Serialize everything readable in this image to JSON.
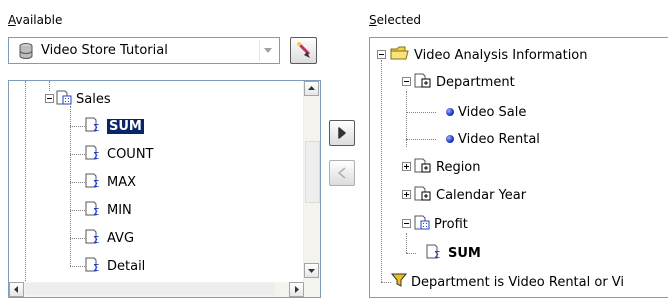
{
  "available": {
    "label_first": "A",
    "label_rest": "vailable",
    "source_value": "Video Store Tutorial",
    "tree": [
      {
        "id": "sales",
        "label": "Sales",
        "icon": "folder-grid-icon"
      },
      {
        "id": "sum",
        "label": "SUM",
        "icon": "sigma-icon",
        "selected": true
      },
      {
        "id": "count",
        "label": "COUNT",
        "icon": "sigma-icon"
      },
      {
        "id": "max",
        "label": "MAX",
        "icon": "sigma-icon"
      },
      {
        "id": "min",
        "label": "MIN",
        "icon": "sigma-icon"
      },
      {
        "id": "avg",
        "label": "AVG",
        "icon": "sigma-icon"
      },
      {
        "id": "detail",
        "label": "Detail",
        "icon": "sigma-icon"
      }
    ]
  },
  "selected": {
    "label_first": "S",
    "label_rest": "elected",
    "tree": [
      {
        "id": "root",
        "label": "Video Analysis Information",
        "icon": "folder-icon"
      },
      {
        "id": "department",
        "label": "Department",
        "icon": "dimension-icon"
      },
      {
        "id": "video-sale",
        "label": "Video Sale",
        "icon": "dot-icon"
      },
      {
        "id": "video-rental",
        "label": "Video Rental",
        "icon": "dot-icon"
      },
      {
        "id": "region",
        "label": "Region",
        "icon": "dimension-icon"
      },
      {
        "id": "calendar-year",
        "label": "Calendar Year",
        "icon": "dimension-icon"
      },
      {
        "id": "profit",
        "label": "Profit",
        "icon": "folder-grid-icon"
      },
      {
        "id": "profit-sum",
        "label": "SUM",
        "icon": "sigma-icon"
      },
      {
        "id": "condition",
        "label": "Department is Video Rental or Vi",
        "icon": "filter-icon"
      }
    ]
  },
  "buttons": {
    "add_icon": "chevron-right-icon",
    "remove_icon": "chevron-left-icon",
    "source_picker_icon": "wand-icon"
  },
  "colors": {
    "selection": "#0a246a",
    "border": "#7f9db9",
    "background": "#ffffff"
  }
}
